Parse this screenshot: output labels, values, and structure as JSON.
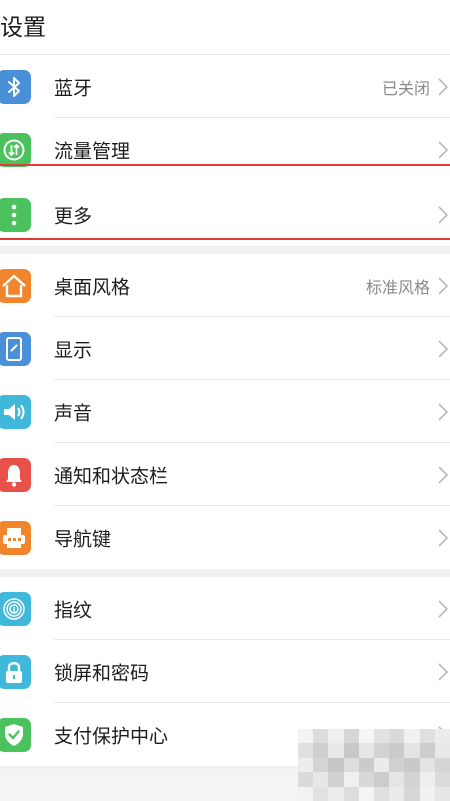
{
  "header": {
    "title": "设置"
  },
  "colors": {
    "bluetooth": "#4a90d9",
    "data": "#4cc25e",
    "more": "#4cc25e",
    "theme": "#f0852d",
    "display": "#4a90d9",
    "sound": "#3fb8d9",
    "notification": "#e8504a",
    "navkey": "#f0852d",
    "fingerprint": "#3fb8d9",
    "lock": "#3fb8d9",
    "payment": "#4cc25e",
    "highlight": "#e53935"
  },
  "groups": [
    {
      "items": [
        {
          "label": "蓝牙",
          "value": "已关闭",
          "icon": "bluetooth-icon"
        },
        {
          "label": "流量管理",
          "value": "",
          "icon": "data-usage-icon"
        },
        {
          "label": "更多",
          "value": "",
          "icon": "more-vertical-icon"
        }
      ]
    },
    {
      "items": [
        {
          "label": "桌面风格",
          "value": "标准风格",
          "icon": "home-icon"
        },
        {
          "label": "显示",
          "value": "",
          "icon": "display-icon"
        },
        {
          "label": "声音",
          "value": "",
          "icon": "speaker-icon"
        },
        {
          "label": "通知和状态栏",
          "value": "",
          "icon": "bell-icon"
        },
        {
          "label": "导航键",
          "value": "",
          "icon": "navigation-keys-icon"
        }
      ]
    },
    {
      "items": [
        {
          "label": "指纹",
          "value": "",
          "icon": "fingerprint-icon"
        },
        {
          "label": "锁屏和密码",
          "value": "",
          "icon": "lock-icon"
        },
        {
          "label": "支付保护中心",
          "value": "",
          "icon": "shield-check-icon"
        }
      ]
    }
  ]
}
